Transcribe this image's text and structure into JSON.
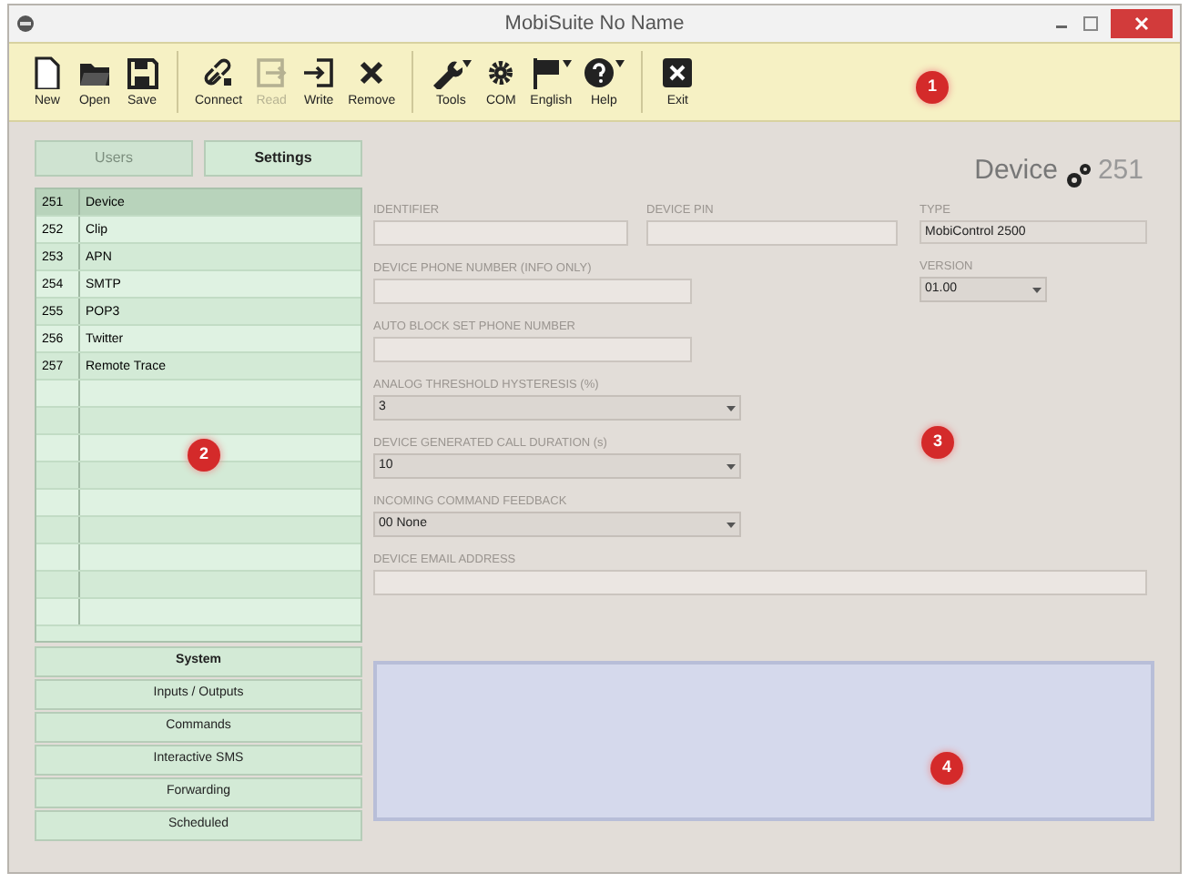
{
  "window": {
    "title": "MobiSuite No Name"
  },
  "toolbar": {
    "groups": [
      [
        {
          "label": "New",
          "disabled": false,
          "dropdown": false
        },
        {
          "label": "Open",
          "disabled": false,
          "dropdown": false
        },
        {
          "label": "Save",
          "disabled": false,
          "dropdown": false
        }
      ],
      [
        {
          "label": "Connect",
          "disabled": false,
          "dropdown": false
        },
        {
          "label": "Read",
          "disabled": true,
          "dropdown": false
        },
        {
          "label": "Write",
          "disabled": false,
          "dropdown": false
        },
        {
          "label": "Remove",
          "disabled": false,
          "dropdown": false
        }
      ],
      [
        {
          "label": "Tools",
          "disabled": false,
          "dropdown": true
        },
        {
          "label": "COM",
          "disabled": false,
          "dropdown": false
        },
        {
          "label": "English",
          "disabled": false,
          "dropdown": true
        },
        {
          "label": "Help",
          "disabled": false,
          "dropdown": true
        }
      ],
      [
        {
          "label": "Exit",
          "disabled": false,
          "dropdown": false
        }
      ]
    ]
  },
  "top_buttons": [
    {
      "label": "Users",
      "disabled": true,
      "selected": false
    },
    {
      "label": "Settings",
      "disabled": false,
      "selected": true
    }
  ],
  "settings_list": [
    {
      "number": "251",
      "name": "Device",
      "selected": true
    },
    {
      "number": "252",
      "name": "Clip",
      "selected": false
    },
    {
      "number": "253",
      "name": "APN",
      "selected": false
    },
    {
      "number": "254",
      "name": "SMTP",
      "selected": false
    },
    {
      "number": "255",
      "name": "POP3",
      "selected": false
    },
    {
      "number": "256",
      "name": "Twitter",
      "selected": false
    },
    {
      "number": "257",
      "name": "Remote Trace",
      "selected": false
    }
  ],
  "nav_buttons": [
    {
      "label": "System",
      "selected": true
    },
    {
      "label": "Inputs / Outputs",
      "selected": false
    },
    {
      "label": "Commands",
      "selected": false
    },
    {
      "label": "Interactive SMS",
      "selected": false
    },
    {
      "label": "Forwarding",
      "selected": false
    },
    {
      "label": "Scheduled",
      "selected": false
    }
  ],
  "device_header": {
    "title": "Device",
    "number": "251"
  },
  "fields": {
    "identifier": {
      "label": "IDENTIFIER"
    },
    "device_pin": {
      "label": "DEVICE PIN"
    },
    "type": {
      "label": "TYPE",
      "value": "MobiControl 2500"
    },
    "phone": {
      "label": "DEVICE PHONE NUMBER (INFO ONLY)"
    },
    "version": {
      "label": "VERSION",
      "value": "01.00"
    },
    "auto_block": {
      "label": "AUTO BLOCK SET PHONE NUMBER"
    },
    "selects": [
      {
        "label": "ANALOG THRESHOLD HYSTERESIS (%)",
        "value": "3"
      },
      {
        "label": "DEVICE GENERATED CALL DURATION (s)",
        "value": "10"
      },
      {
        "label": "INCOMING COMMAND FEEDBACK",
        "value": "00 None"
      }
    ],
    "email": {
      "label": "DEVICE EMAIL ADDRESS"
    }
  },
  "annotations": [
    {
      "label": "1"
    },
    {
      "label": "2"
    },
    {
      "label": "3"
    },
    {
      "label": "4"
    }
  ]
}
